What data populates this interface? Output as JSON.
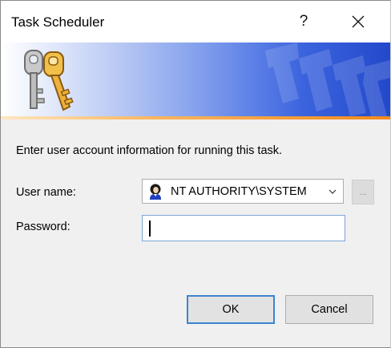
{
  "window": {
    "title": "Task Scheduler",
    "help_label": "?",
    "close_icon": "close-icon"
  },
  "banner": {
    "icon": "keys-icon",
    "colors": {
      "gradient_start": "#ffffff",
      "gradient_end": "#2349cb",
      "accent_line": "#f08a1d"
    }
  },
  "form": {
    "instruction": "Enter user account information for running this task.",
    "user_name_label": "User name:",
    "user_name_value": "NT AUTHORITY\\SYSTEM",
    "user_icon": "user-icon",
    "browse_label": "...",
    "password_label": "Password:",
    "password_value": ""
  },
  "buttons": {
    "ok_label": "OK",
    "cancel_label": "Cancel"
  }
}
